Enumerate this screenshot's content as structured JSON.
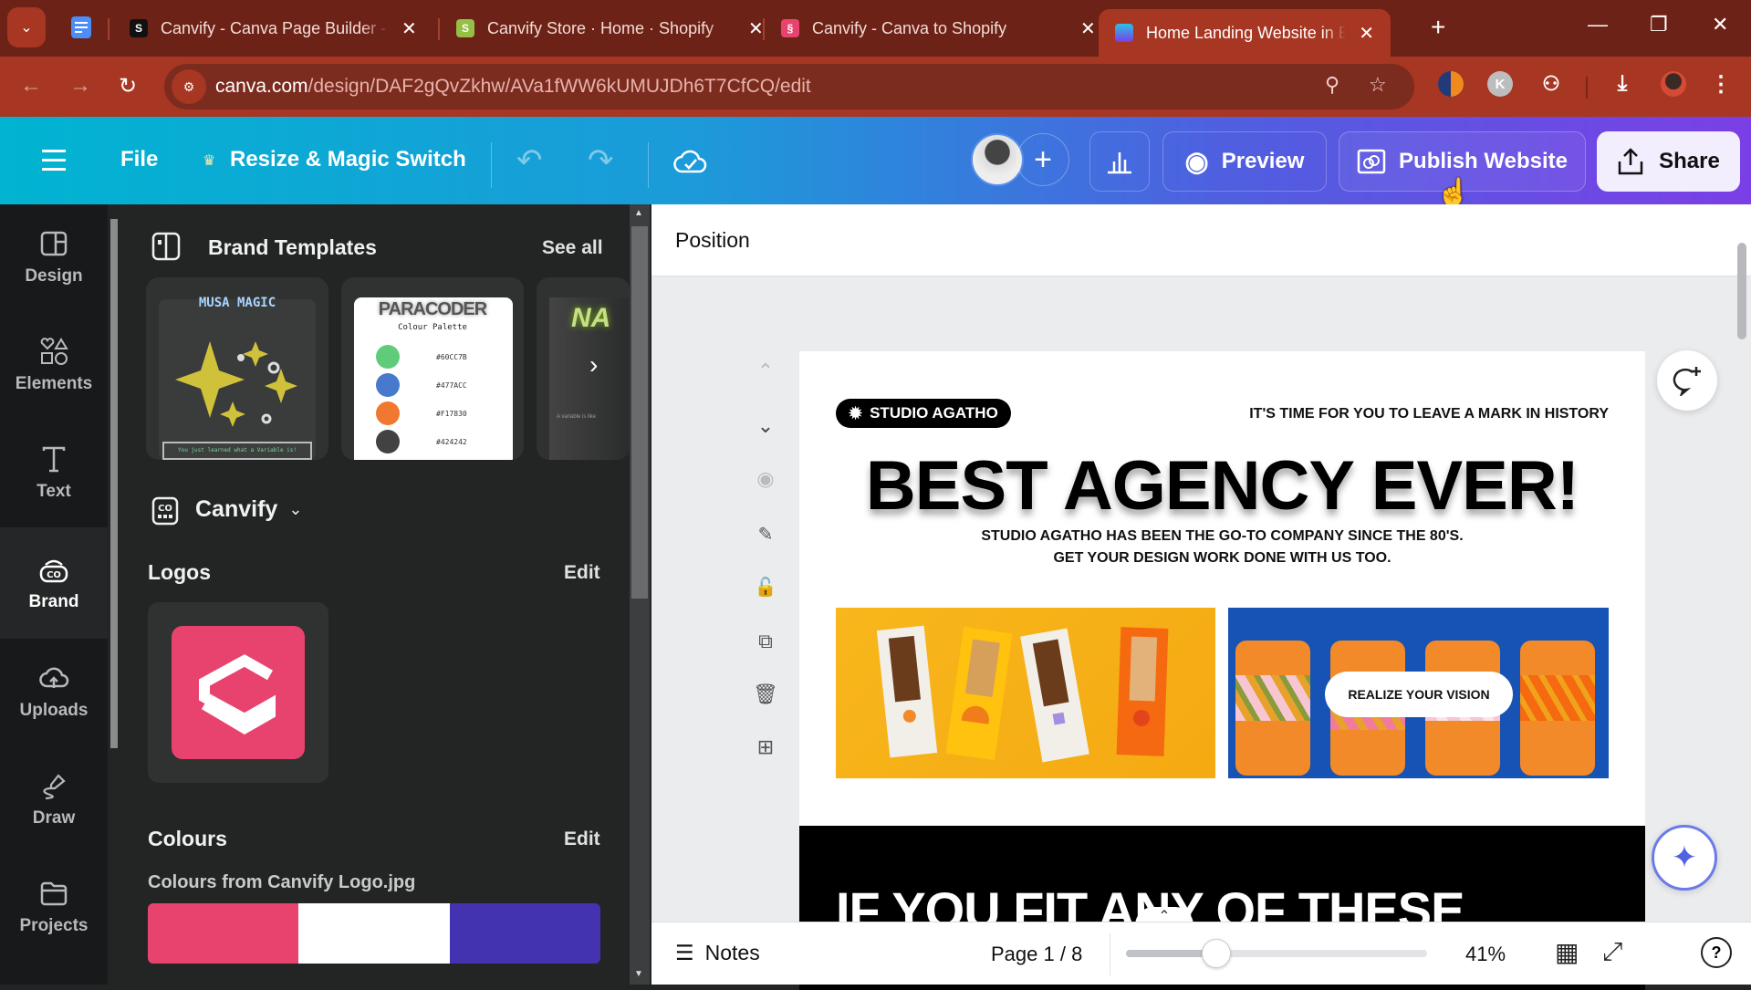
{
  "browser": {
    "tabs": [
      {
        "title": "Canvify - Canva Page Builder - C",
        "favicon": "shopify-icon-black",
        "active": false
      },
      {
        "title": "Canvify Store · Home · Shopify",
        "favicon": "shopify-icon-green",
        "active": false
      },
      {
        "title": "Canvify - Canva to Shopify",
        "favicon": "canvify-icon",
        "active": false
      },
      {
        "title": "Home Landing Website in Black",
        "favicon": "canva-website-icon",
        "active": true
      }
    ],
    "url_host": "canva.com",
    "url_path": "/design/DAF2gQvZkhw/AVa1fWW6kUMUJDh6T7CfCQ/edit",
    "extension_k_label": "K",
    "colors": {
      "tabstrip": "#6c2216",
      "toolbar": "#a73622"
    }
  },
  "toolbar": {
    "menu_label": "File",
    "resize_label": "Resize & Magic Switch",
    "preview_label": "Preview",
    "publish_label": "Publish Website",
    "share_label": "Share"
  },
  "rail": {
    "items": [
      {
        "label": "Design",
        "icon": "layout-icon"
      },
      {
        "label": "Elements",
        "icon": "shapes-icon"
      },
      {
        "label": "Text",
        "icon": "text-icon"
      },
      {
        "label": "Brand",
        "icon": "brand-icon",
        "active": true
      },
      {
        "label": "Uploads",
        "icon": "upload-cloud-icon"
      },
      {
        "label": "Draw",
        "icon": "draw-icon"
      },
      {
        "label": "Projects",
        "icon": "folder-icon"
      }
    ]
  },
  "panel": {
    "brand_templates": {
      "title": "Brand Templates",
      "see_all": "See all",
      "cards": [
        {
          "title": "MUSA MAGIC",
          "caption": "You just learned what a Variable is!"
        },
        {
          "title": "PARACODER",
          "subtitle": "Colour Palette",
          "swatches": [
            {
              "hex": "#60CC7B",
              "label": "#60CC7B"
            },
            {
              "hex": "#477ACC",
              "label": "#477ACC"
            },
            {
              "hex": "#F17830",
              "label": "#F17830"
            },
            {
              "hex": "#424242",
              "label": "#424242"
            }
          ]
        },
        {
          "title": "NA",
          "caption": "A variable is like"
        }
      ]
    },
    "brand_kit": {
      "name": "Canvify"
    },
    "logos": {
      "title": "Logos",
      "edit": "Edit"
    },
    "colours": {
      "title": "Colours",
      "edit": "Edit",
      "palette_name": "Colours from Canvify Logo.jpg",
      "swatches": [
        "#E8436E",
        "#FFFFFF",
        "#4433B0"
      ]
    }
  },
  "editor": {
    "position_label": "Position",
    "page": {
      "badge": "STUDIO AGATHO",
      "tagline": "IT'S TIME FOR YOU TO LEAVE A MARK IN HISTORY",
      "headline": "BEST AGENCY EVER!",
      "sub1": "STUDIO AGATHO HAS BEEN THE GO-TO COMPANY SINCE THE 80'S.",
      "sub2": "GET YOUR DESIGN WORK DONE WITH US TOO.",
      "cta": "REALIZE YOUR VISION",
      "section2_heading": "IF YOU FIT ANY OF THESE"
    }
  },
  "bottombar": {
    "notes_label": "Notes",
    "page_indicator": "Page 1 / 8",
    "zoom_label": "41%",
    "zoom_fraction": 0.41
  }
}
